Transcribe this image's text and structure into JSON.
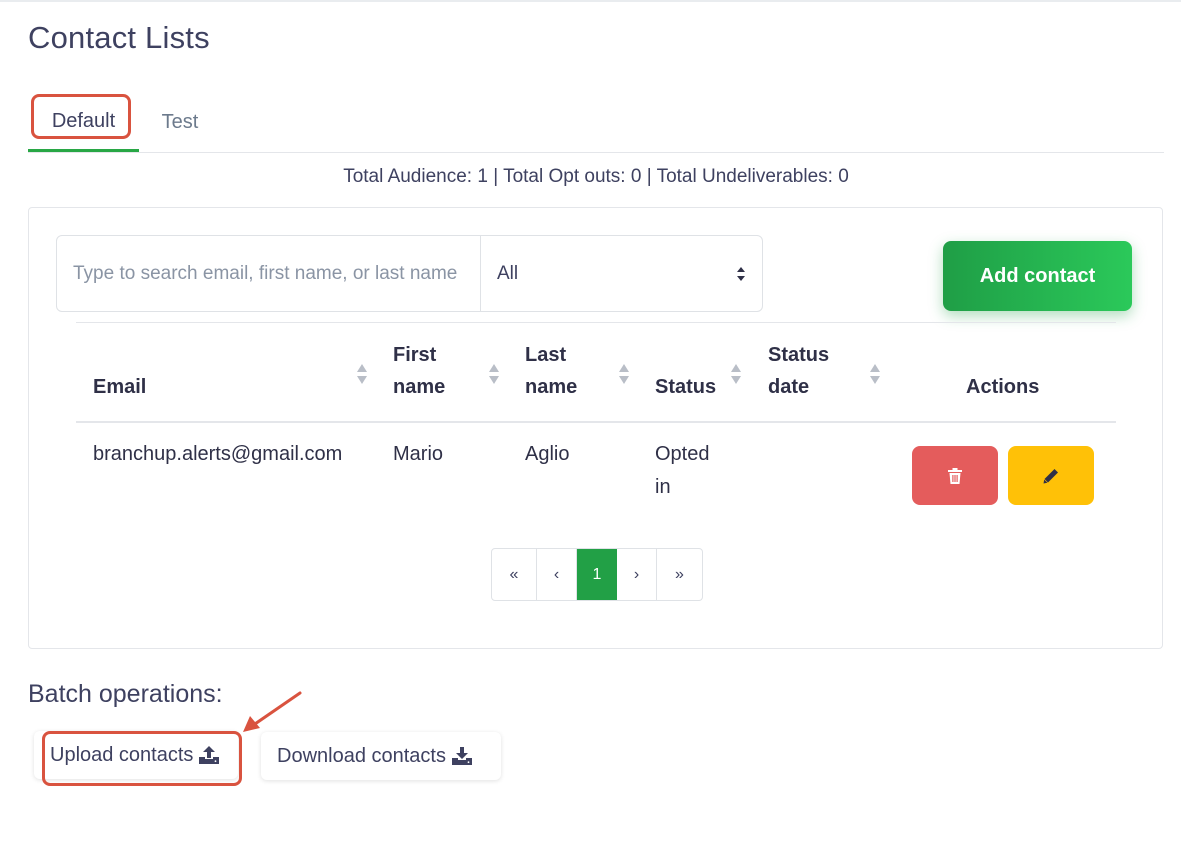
{
  "page": {
    "title": "Contact Lists"
  },
  "tabs": [
    {
      "label": "Default",
      "active": true
    },
    {
      "label": "Test",
      "active": false
    }
  ],
  "stats": "Total Audience: 1 | Total Opt outs: 0 | Total Undeliverables: 0",
  "search": {
    "placeholder": "Type to search email, first name, or last name",
    "value": ""
  },
  "filter": {
    "selected": "All"
  },
  "add_contact_label": "Add contact",
  "table": {
    "headers": {
      "email": "Email",
      "first_name": [
        "First",
        "name"
      ],
      "last_name": [
        "Last",
        "name"
      ],
      "status": "Status",
      "status_date": [
        "Status",
        "date"
      ],
      "actions": "Actions"
    },
    "rows": [
      {
        "email": "branchup.alerts@gmail.com",
        "first_name": "Mario",
        "last_name": "Aglio",
        "status": [
          "Opted",
          "in"
        ],
        "status_date": ""
      }
    ]
  },
  "pagination": {
    "first": "«",
    "prev": "‹",
    "current": "1",
    "next": "›",
    "last": "»"
  },
  "batch": {
    "title": "Batch operations:",
    "upload_label": "Upload contacts",
    "download_label": "Download contacts"
  },
  "icons": {
    "sort": "sort-icon",
    "trash": "trash-icon",
    "pencil": "pencil-icon",
    "upload": "upload-icon",
    "download": "download-icon",
    "select": "select-arrows-icon"
  },
  "colors": {
    "primary_green": "#28a745",
    "danger": "#e45c5c",
    "warning": "#ffc107",
    "annotation_red": "#d9533f",
    "heading": "#3e4160"
  }
}
